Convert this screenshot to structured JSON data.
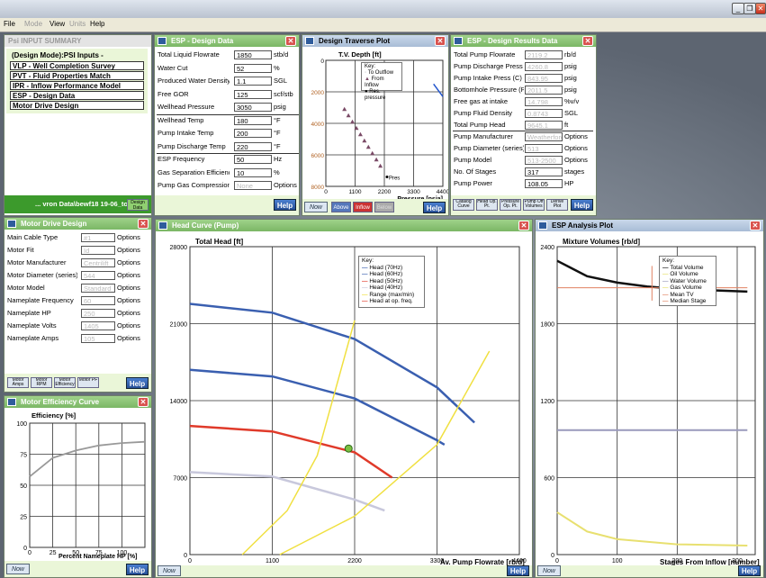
{
  "menu": [
    "File",
    "Mode",
    "View",
    "Units",
    "Help"
  ],
  "summary": {
    "title": "Psi INPUT SUMMARY",
    "heading": "(Design Mode):PSI Inputs -",
    "items": [
      "VLP - Well Completion Survey",
      "PVT - Fluid Properties Match",
      "IPR - Inflow Performance Model",
      "ESP - Design Data",
      "Motor Drive Design"
    ],
    "footer": "... vron Data\\bewf18 19-06_to_P300",
    "design_btn": "Design Data"
  },
  "design": {
    "title": "ESP - Design Data",
    "rows": [
      {
        "label": "Total Liquid Flowrate",
        "value": "1850",
        "unit": "stb/d"
      },
      {
        "label": "Water Cut",
        "value": "52",
        "unit": "%"
      },
      {
        "label": "Produced Water Density",
        "value": "1.1",
        "unit": "SGL"
      },
      {
        "label": "Free GOR",
        "value": "125",
        "unit": "scf/stb"
      },
      {
        "label": "Wellhead Pressure",
        "value": "3050",
        "unit": "psig"
      },
      {
        "label": "Wellhead Temp",
        "value": "180",
        "unit": "°F"
      },
      {
        "label": "Pump Intake Temp",
        "value": "200",
        "unit": "°F"
      },
      {
        "label": "Pump Discharge Temp",
        "value": "220",
        "unit": "°F"
      },
      {
        "label": "ESP Frequency",
        "value": "50",
        "unit": "Hz"
      },
      {
        "label": "Gas Separation Efficiency",
        "value": "10",
        "unit": "%"
      },
      {
        "label": "Pump Gas Compression",
        "value": "None",
        "unit": "Options"
      }
    ],
    "help": "Help"
  },
  "traverse": {
    "title": "Design Traverse Plot",
    "ylabel": "T.V. Depth [ft]",
    "xlabel": "Pressure [psia]",
    "yticks": [
      "0",
      "2000",
      "4000",
      "6000",
      "8000"
    ],
    "xticks": [
      "0",
      "1100",
      "2200",
      "3300",
      "4400"
    ],
    "key_title": "Key:",
    "key": [
      "To Outflow",
      "From Inflow",
      "Res. pressure"
    ],
    "annotation": "Pres",
    "buttons": [
      "Above",
      "Inflow",
      "Below"
    ],
    "help": "Help"
  },
  "results": {
    "title": "ESP - Design Results Data",
    "rows": [
      {
        "label": "Total Pump Flowrate",
        "value": "2119.2",
        "unit": "rb/d"
      },
      {
        "label": "Pump Discharge Press (C)",
        "value": "4260.8",
        "unit": "psig"
      },
      {
        "label": "Pump Intake Press (C)",
        "value": "843.95",
        "unit": "psig"
      },
      {
        "label": "Bottomhole Pressure (Pwf)",
        "value": "2011.5",
        "unit": "psig"
      },
      {
        "label": "Free gas at intake",
        "value": "14.798",
        "unit": "%v/v"
      },
      {
        "label": "Pump Fluid Density",
        "value": "0.8743",
        "unit": "SGL"
      },
      {
        "label": "Total Pump Head",
        "value": "9645.1",
        "unit": "ft"
      },
      {
        "label": "Pump Manufacturer",
        "value": "Weatherford",
        "unit": "Options"
      },
      {
        "label": "Pump Diameter (series)",
        "value": "513",
        "unit": "Options"
      },
      {
        "label": "Pump Model",
        "value": "513-2500",
        "unit": "Options"
      },
      {
        "label": "No. Of Stages",
        "value": "317",
        "unit": "stages"
      },
      {
        "label": "Pump Power",
        "value": "108.05",
        "unit": "HP"
      }
    ],
    "buttons": [
      "Catalog Curve",
      "Head Op. Pt.",
      "Pressure Op. Pt.",
      "Pump Off Volumes",
      "Derive Plot"
    ],
    "help": "Help"
  },
  "motor": {
    "title": "Motor Drive Design",
    "rows": [
      {
        "label": "Main Cable Type",
        "value": "#1",
        "unit": "Options"
      },
      {
        "label": "Motor Fit",
        "value": "Id",
        "unit": "Options"
      },
      {
        "label": "Motor Manufacturer",
        "value": "Centrilift",
        "unit": "Options"
      },
      {
        "label": "Motor Diameter (series)",
        "value": "544",
        "unit": "Options"
      },
      {
        "label": "Motor Model",
        "value": "Standard",
        "unit": "Options"
      },
      {
        "label": "Nameplate Frequency",
        "value": "60",
        "unit": "Options"
      },
      {
        "label": "Nameplate HP",
        "value": "250",
        "unit": "Options"
      },
      {
        "label": "Nameplate Volts",
        "value": "1405",
        "unit": "Options"
      },
      {
        "label": "Nameplate Amps",
        "value": "105",
        "unit": "Options"
      }
    ],
    "buttons": [
      "Motor Amps",
      "Motor RPM",
      "Motor Efficiency",
      "Motor PF"
    ],
    "help": "Help"
  },
  "efficiency": {
    "title": "Motor Efficiency Curve",
    "ylabel": "Efficiency [%]",
    "xlabel": "Percent Nameplate HP [%]",
    "yticks": [
      "0",
      "25",
      "50",
      "75",
      "100"
    ],
    "xticks": [
      "0",
      "25",
      "50",
      "75",
      "100"
    ],
    "help": "Help",
    "nav": "Now"
  },
  "head": {
    "title": "Head Curve (Pump)",
    "ylabel": "Total Head [ft]",
    "xlabel": "Av. Pump Flowrate [rb/d]",
    "yticks": [
      "0",
      "7000",
      "14000",
      "21000",
      "28000"
    ],
    "xticks": [
      "0",
      "1100",
      "2200",
      "3300",
      "4400"
    ],
    "key_title": "Key:",
    "key": [
      {
        "label": "Head (70Hz)",
        "color": "#3a5fb0"
      },
      {
        "label": "Head (60Hz)",
        "color": "#3a5fb0"
      },
      {
        "label": "Head (50Hz)",
        "color": "#e03a2a"
      },
      {
        "label": "Head (40Hz)",
        "color": "#c8c8dc"
      },
      {
        "label": "Range (max/min)",
        "color": "#f0e040"
      },
      {
        "label": "Head at op. freq.",
        "color": "#e03a2a"
      }
    ],
    "help": "Help",
    "nav": "Now"
  },
  "analysis": {
    "title": "ESP Analysis Plot",
    "ylabel": "Mixture Volumes [rb/d]",
    "xlabel": "Stages From Inflow [number]",
    "yticks": [
      "0",
      "600",
      "1200",
      "1800",
      "2400"
    ],
    "xticks": [
      "0",
      "100",
      "200",
      "300"
    ],
    "key_title": "Key:",
    "key": [
      "Total Volume",
      "Oil Volume",
      "Water Volume",
      "Gas Volume",
      "Mean TV",
      "Median Stage"
    ],
    "help": "Help",
    "nav": "Now"
  },
  "chart_data": [
    {
      "type": "line",
      "title": "Head Curve (Pump)",
      "xlabel": "Av. Pump Flowrate [rb/d]",
      "ylabel": "Total Head [ft]",
      "xlim": [
        0,
        4400
      ],
      "ylim": [
        0,
        28000
      ],
      "series": [
        {
          "name": "Head (70Hz)",
          "x": [
            0,
            1100,
            2200,
            3300,
            3800
          ],
          "y": [
            22800,
            22000,
            19600,
            15200,
            12000
          ]
        },
        {
          "name": "Head (60Hz)",
          "x": [
            0,
            1100,
            2200,
            3300,
            3400
          ],
          "y": [
            16800,
            16200,
            14200,
            10400,
            10000
          ]
        },
        {
          "name": "Head (50Hz)",
          "x": [
            0,
            1100,
            2200,
            2700
          ],
          "y": [
            11700,
            11200,
            9300,
            7000
          ]
        },
        {
          "name": "Head (40Hz)",
          "x": [
            0,
            1100,
            2200,
            2600
          ],
          "y": [
            7500,
            7100,
            5000,
            4000
          ]
        },
        {
          "name": "Range (max/min)",
          "x": [
            700,
            1300,
            1700,
            2200
          ],
          "y": [
            0,
            4000,
            9000,
            21300
          ]
        },
        {
          "name": "Range (max/min)",
          "x": [
            1200,
            2200,
            3300,
            4000
          ],
          "y": [
            0,
            3500,
            10000,
            18500
          ]
        }
      ],
      "op_point": {
        "x": 2119,
        "y": 9645
      }
    },
    {
      "type": "line",
      "title": "ESP Analysis Plot",
      "xlabel": "Stages From Inflow [number]",
      "ylabel": "Mixture Volumes [rb/d]",
      "xlim": [
        0,
        330
      ],
      "ylim": [
        0,
        2400
      ],
      "series": [
        {
          "name": "Total Volume",
          "x": [
            0,
            50,
            100,
            150,
            200,
            317
          ],
          "y": [
            2290,
            2170,
            2120,
            2090,
            2070,
            2050
          ]
        },
        {
          "name": "Water Volume",
          "x": [
            0,
            317
          ],
          "y": [
            970,
            970
          ]
        },
        {
          "name": "Gas Volume",
          "x": [
            0,
            50,
            100,
            200,
            317
          ],
          "y": [
            330,
            180,
            120,
            80,
            70
          ]
        },
        {
          "name": "Mean TV",
          "x": [
            0,
            317
          ],
          "y": [
            2080,
            2080
          ]
        },
        {
          "name": "Median Stage",
          "x": [
            158,
            158
          ],
          "y": [
            1980,
            2250
          ]
        }
      ]
    },
    {
      "type": "scatter",
      "title": "Design Traverse Plot",
      "xlabel": "Pressure [psia]",
      "ylabel": "T.V. Depth [ft]",
      "xlim": [
        0,
        4400
      ],
      "ylim": [
        0,
        8000
      ],
      "series": [
        {
          "name": "From Inflow",
          "x": [
            700,
            850,
            1000,
            1150,
            1300,
            1450,
            1600,
            1750,
            1900,
            2050
          ],
          "y": [
            3100,
            3500,
            3900,
            4300,
            4700,
            5100,
            5500,
            5900,
            6300,
            6700
          ]
        },
        {
          "name": "Res. pressure",
          "x": [
            2300
          ],
          "y": [
            7400
          ]
        }
      ]
    },
    {
      "type": "line",
      "title": "Motor Efficiency Curve",
      "xlabel": "Percent Nameplate HP [%]",
      "ylabel": "Efficiency [%]",
      "xlim": [
        0,
        125
      ],
      "ylim": [
        0,
        100
      ],
      "series": [
        {
          "name": "",
          "x": [
            0,
            25,
            50,
            75,
            100,
            125
          ],
          "y": [
            57,
            72,
            78,
            82,
            84,
            85
          ]
        }
      ]
    }
  ]
}
